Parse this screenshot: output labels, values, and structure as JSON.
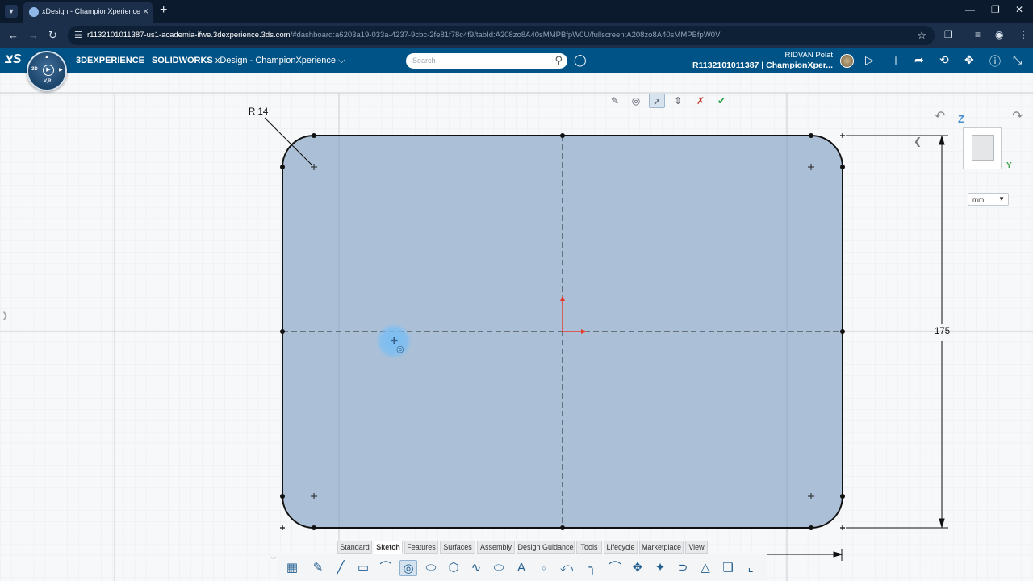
{
  "browser": {
    "tab_title": "xDesign - ChampionXperience",
    "url_host": "r1132101011387-us1-academia-ifwe.3dexperience.3ds.com",
    "url_rest": "/#dashboard:a6203a19-033a-4237-9cbc-2fe81f78c4f9/tabId:A208zo8A40sMMPBfpW0U/fullscreen:A208zo8A40sMMPBfpW0V"
  },
  "app": {
    "brand": "3DEXPERIENCE",
    "separator": " | ",
    "product": "SOLIDWORKS",
    "app_name": "xDesign - ChampionXperience",
    "search_placeholder": "Search",
    "user_name": "RIDVAN Polat",
    "user_org": "R1132101011387 | ChampionXper...",
    "compass_label": "V,R",
    "compass_3d": "3D"
  },
  "canvas": {
    "radius_label": "R 14",
    "height_dim": "175",
    "unit": "mm",
    "axis_z": "Z",
    "axis_y": "Y"
  },
  "bottom_tabs": [
    "Standard",
    "Sketch",
    "Features",
    "Surfaces",
    "Assembly",
    "Design Guidance",
    "Tools",
    "Lifecycle",
    "Marketplace",
    "View"
  ],
  "active_tab": "Sketch",
  "colors": {
    "header": "#005386",
    "sketch_fill": "#a7bdd5",
    "origin_axis": "#e53b2e"
  }
}
